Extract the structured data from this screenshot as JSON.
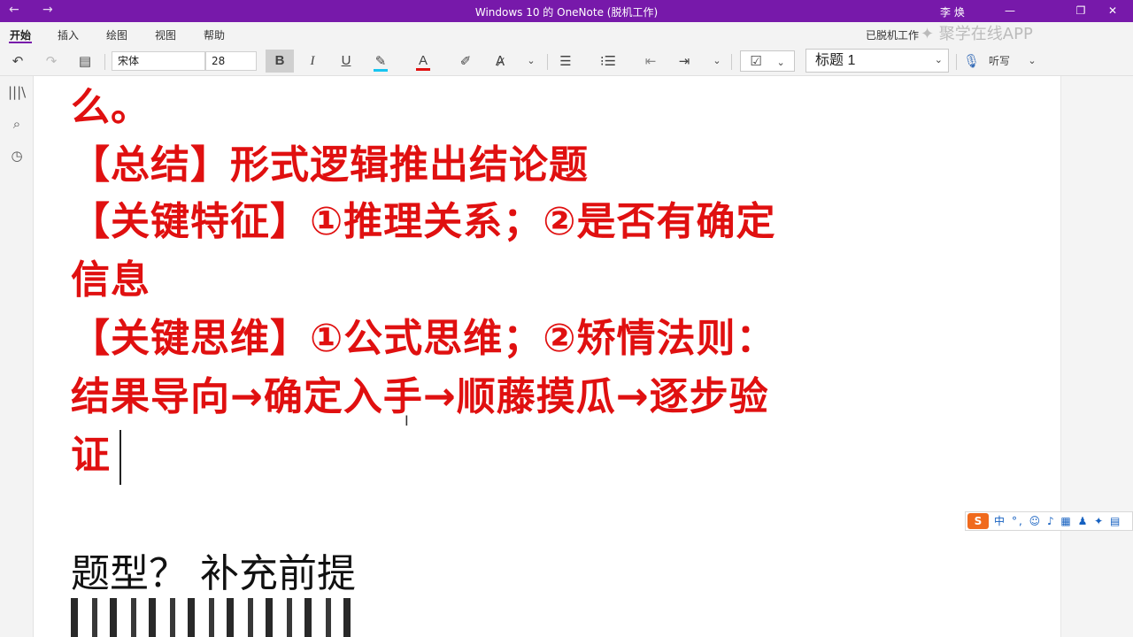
{
  "titlebar": {
    "title": "Windows 10 的 OneNote (脱机工作)",
    "user": "李 焕",
    "back_icon": "←",
    "forward_icon": "→",
    "minimize_icon": "—",
    "restore_icon": "❐",
    "close_icon": "✕"
  },
  "tabs": {
    "items": [
      "开始",
      "插入",
      "绘图",
      "视图",
      "帮助"
    ],
    "offline_status": "已脱机工作"
  },
  "toolbar": {
    "font_name": "宋体",
    "font_size": "28",
    "bold": "B",
    "italic": "I",
    "underline": "U",
    "font_color": "A",
    "style": "标题 1",
    "dictate": "听写"
  },
  "note": {
    "line1": "么。",
    "line2": "【总结】形式逻辑推出结论题",
    "line3": "【关键特征】①推理关系；②是否有确定",
    "line4": "信息",
    "line5": "【关键思维】①公式思维；②矫情法则：",
    "line6": "结果导向→确定入手→顺藤摸瓜→逐步验",
    "line7": "证",
    "line8": "题型？ 补充前提"
  },
  "ime": {
    "logo": "S",
    "mode": "中",
    "icons": "°, ☺ ♪ ▦ ♟ ✦ ▤"
  },
  "watermark": "聚学在线APP",
  "colors": {
    "accent": "#7719aa",
    "note_red": "#e01010",
    "ime_orange": "#f06a1d"
  }
}
